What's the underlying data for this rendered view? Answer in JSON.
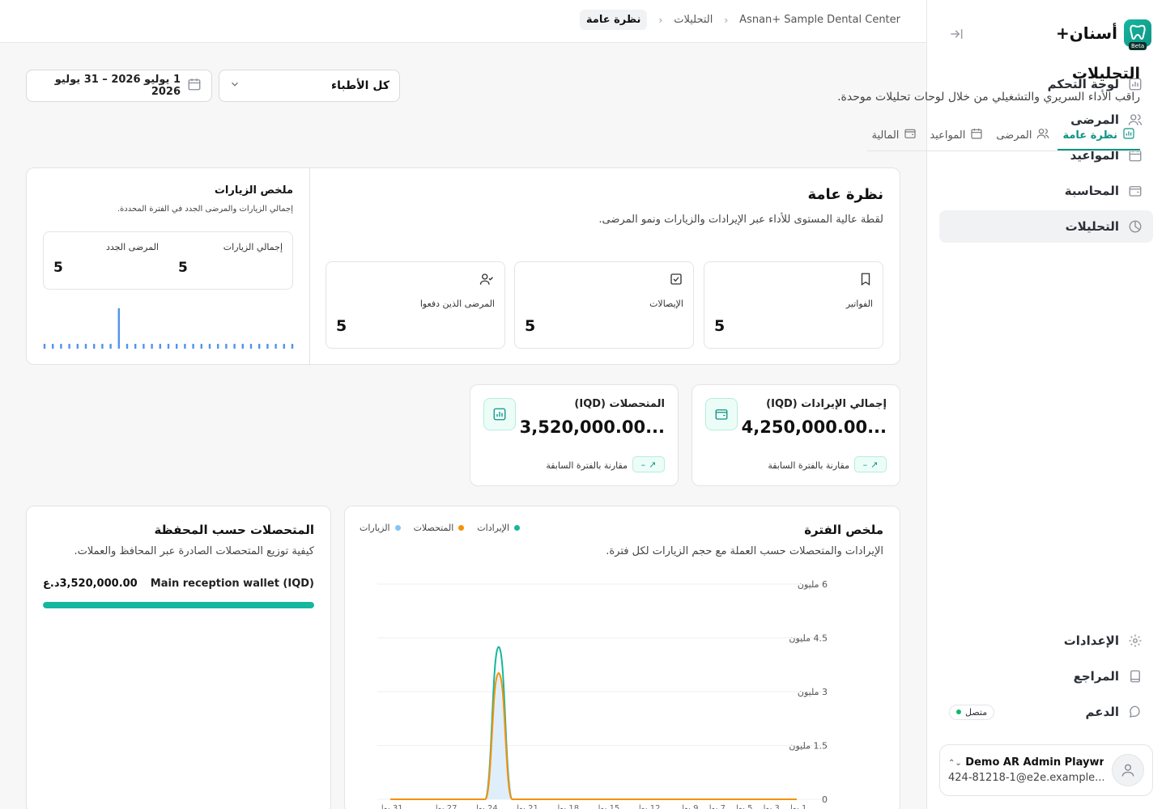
{
  "sidebar": {
    "brand": "أسنان+",
    "beta": "Beta",
    "nav": [
      {
        "label": "لوحة التحكم",
        "icon": "dashboard-icon"
      },
      {
        "label": "المرضى",
        "icon": "users-icon"
      },
      {
        "label": "المواعيد",
        "icon": "calendar-icon"
      },
      {
        "label": "المحاسبة",
        "icon": "wallet-icon"
      },
      {
        "label": "التحليلات",
        "icon": "pie-chart-icon",
        "active": true
      }
    ],
    "bottom": [
      {
        "label": "الإعدادات",
        "icon": "gear-icon"
      },
      {
        "label": "المراجع",
        "icon": "book-icon"
      },
      {
        "label": "الدعم",
        "icon": "chat-icon"
      }
    ],
    "support_status": "متصل",
    "user": {
      "name": "Demo AR Admin Playwright",
      "email": "424-81218-1@e2e.example..."
    }
  },
  "topbar": {
    "breadcrumb": [
      "Asnan+ Sample Dental Center",
      "التحليلات",
      "نظرة عامة"
    ]
  },
  "header": {
    "title": "التحليلات",
    "subtitle": "راقب الأداء السريري والتشغيلي من خلال لوحات تحليلات موحدة.",
    "doctor_select": "كل الأطباء",
    "date_range": "1 يوليو 2026 – 31 يوليو 2026"
  },
  "tabs": [
    {
      "label": "نظرة عامة",
      "icon": "bar-chart-icon",
      "active": true
    },
    {
      "label": "المرضى",
      "icon": "users-icon"
    },
    {
      "label": "المواعيد",
      "icon": "calendar-icon"
    },
    {
      "label": "المالية",
      "icon": "wallet-icon"
    }
  ],
  "overview": {
    "title": "نظرة عامة",
    "subtitle": "لقطة عالية المستوى للأداء عبر الإيرادات والزيارات ونمو المرضى.",
    "metrics": [
      {
        "label": "الفواتير",
        "value": "5",
        "icon": "bookmark-icon"
      },
      {
        "label": "الإيصالات",
        "value": "5",
        "icon": "check-square-icon"
      },
      {
        "label": "المرضى الذين دفعوا",
        "value": "5",
        "icon": "user-check-icon"
      }
    ]
  },
  "visits_summary": {
    "title": "ملخص الزيارات",
    "subtitle": "إجمالي الزيارات والمرضى الجدد في الفترة المحددة.",
    "total_visits_label": "إجمالي الزيارات",
    "total_visits": "5",
    "new_patients_label": "المرضى الجدد",
    "new_patients": "5",
    "daily_visits": [
      0,
      0,
      0,
      0,
      0,
      0,
      0,
      0,
      0,
      5,
      0,
      0,
      0,
      0,
      0,
      0,
      0,
      0,
      0,
      0,
      0,
      0,
      0,
      0,
      0,
      0,
      0,
      0,
      0,
      0,
      0
    ]
  },
  "kpis": [
    {
      "title": "إجمالي الإيرادات (IQD)",
      "value": "4,250,000.00...",
      "compare": "مقارنة بالفترة السابقة",
      "delta": "–",
      "icon": "wallet-icon"
    },
    {
      "title": "المتحصلات (IQD)",
      "value": "3,520,000.00...",
      "compare": "مقارنة بالفترة السابقة",
      "delta": "–",
      "icon": "bar-chart-icon"
    }
  ],
  "period_summary": {
    "title": "ملخص الفترة",
    "subtitle": "الإيرادات والمتحصلات حسب العملة مع حجم الزيارات لكل فترة.",
    "legend": [
      {
        "label": "الإيرادات",
        "color": "#15b79e"
      },
      {
        "label": "المتحصلات",
        "color": "#f79009"
      },
      {
        "label": "الزيارات",
        "color": "#84c5f4"
      }
    ]
  },
  "chart_data": {
    "type": "line",
    "title": "ملخص الفترة",
    "y_tick_labels": [
      "0",
      "1.5 مليون",
      "3 مليون",
      "4.5 مليون",
      "6 مليون"
    ],
    "ylim": [
      0,
      6000000
    ],
    "x_tick_labels": [
      "1 يول",
      "3 يول",
      "5 يول",
      "7 يول",
      "9 يول",
      "12 يول",
      "15 يول",
      "18 يول",
      "21 يول",
      "24 يول",
      "27 يول",
      "31 يول"
    ],
    "x": [
      "1 يول",
      "2 يول",
      "3 يول",
      "4 يول",
      "5 يول",
      "6 يول",
      "7 يول",
      "8 يول",
      "9 يول",
      "10 يول",
      "11 يول",
      "12 يول",
      "13 يول",
      "14 يول",
      "15 يول",
      "16 يول",
      "17 يول",
      "18 يول",
      "19 يول",
      "20 يول",
      "21 يول",
      "22 يول",
      "23 يول",
      "24 يول",
      "25 يول",
      "26 يول",
      "27 يول",
      "28 يول",
      "29 يول",
      "30 يول",
      "31 يول"
    ],
    "series": [
      {
        "name": "الإيرادات",
        "color": "#15b79e",
        "values": [
          0,
          0,
          0,
          0,
          0,
          0,
          0,
          0,
          0,
          0,
          0,
          0,
          0,
          0,
          0,
          0,
          0,
          0,
          0,
          0,
          0,
          0,
          4250000,
          0,
          0,
          0,
          0,
          0,
          0,
          0,
          0
        ]
      },
      {
        "name": "المتحصلات",
        "color": "#f79009",
        "values": [
          0,
          0,
          0,
          0,
          0,
          0,
          0,
          0,
          0,
          0,
          0,
          0,
          0,
          0,
          0,
          0,
          0,
          0,
          0,
          0,
          0,
          0,
          3520000,
          0,
          0,
          0,
          0,
          0,
          0,
          0,
          0
        ]
      },
      {
        "name": "الزيارات",
        "color": "#84c5f4",
        "values": [
          0,
          0,
          0,
          0,
          0,
          0,
          0,
          0,
          0,
          0,
          0,
          0,
          0,
          0,
          0,
          0,
          0,
          0,
          0,
          0,
          0,
          0,
          5,
          0,
          0,
          0,
          0,
          0,
          0,
          0,
          0
        ]
      }
    ]
  },
  "wallets": {
    "title": "المتحصلات حسب المحفظة",
    "subtitle": "كيفية توزيع المتحصلات الصادرة عبر المحافظ والعملات.",
    "items": [
      {
        "name": "Main reception wallet (IQD)",
        "amount": "3,520,000.00د.ع",
        "share": 1.0
      }
    ]
  }
}
